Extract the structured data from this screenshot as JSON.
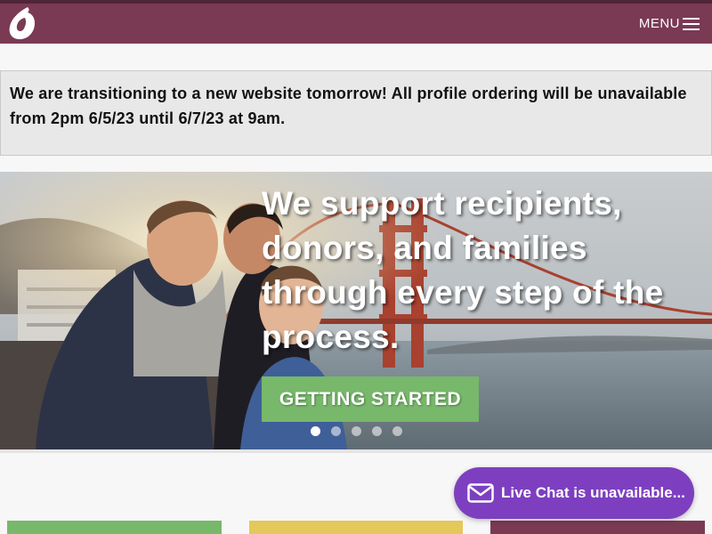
{
  "header": {
    "menu_label": "MENU",
    "logo_icon": "brand-drop-logo-icon",
    "menu_icon": "hamburger-icon"
  },
  "notice": {
    "text": "We are transitioning to a new website tomorrow! All profile ordering will be unavailable from 2pm 6/5/23 until 6/7/23 at 9am."
  },
  "hero": {
    "headline": "We support recipients, donors, and families through every step of the process.",
    "cta_label": "GETTING STARTED",
    "slides_count": 5,
    "active_slide": 1
  },
  "chat": {
    "label": "Live Chat is unavailable...",
    "icon": "mail-icon"
  },
  "cards": [
    {
      "color": "#77b86a"
    },
    {
      "color": "#e4c85a"
    },
    {
      "color": "#7a3a53"
    }
  ],
  "colors": {
    "brand": "#7a3a53",
    "brand_dark": "#4f2537",
    "cta": "#77b86a",
    "chat": "#7d3fc0"
  }
}
